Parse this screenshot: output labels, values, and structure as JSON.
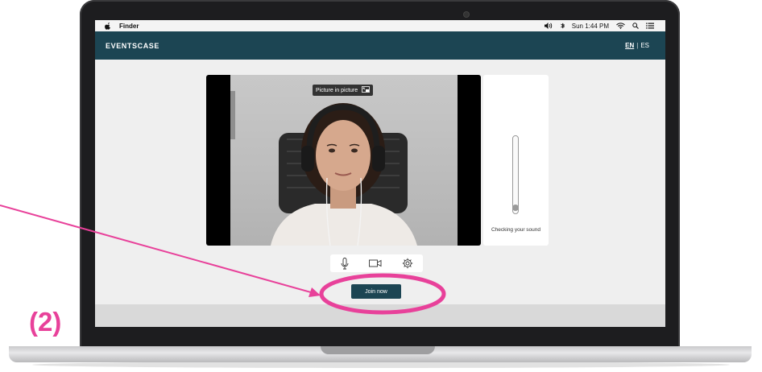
{
  "menubar": {
    "app_name": "Finder",
    "clock": "Sun 1:44 PM"
  },
  "header": {
    "brand": "EVENTSCASE",
    "lang_en": "EN",
    "lang_separator": "|",
    "lang_es": "ES"
  },
  "video": {
    "pip_label": "Picture in picture"
  },
  "mic_check": {
    "label": "Checking your sound"
  },
  "controls": {
    "icons": [
      "microphone-icon",
      "camera-icon",
      "settings-icon"
    ]
  },
  "join_button": {
    "label": "Join now"
  },
  "annotation": {
    "step_label": "(2)",
    "color": "#e8419a"
  },
  "colors": {
    "header_bg": "#1c4553",
    "accent": "#e8419a"
  }
}
